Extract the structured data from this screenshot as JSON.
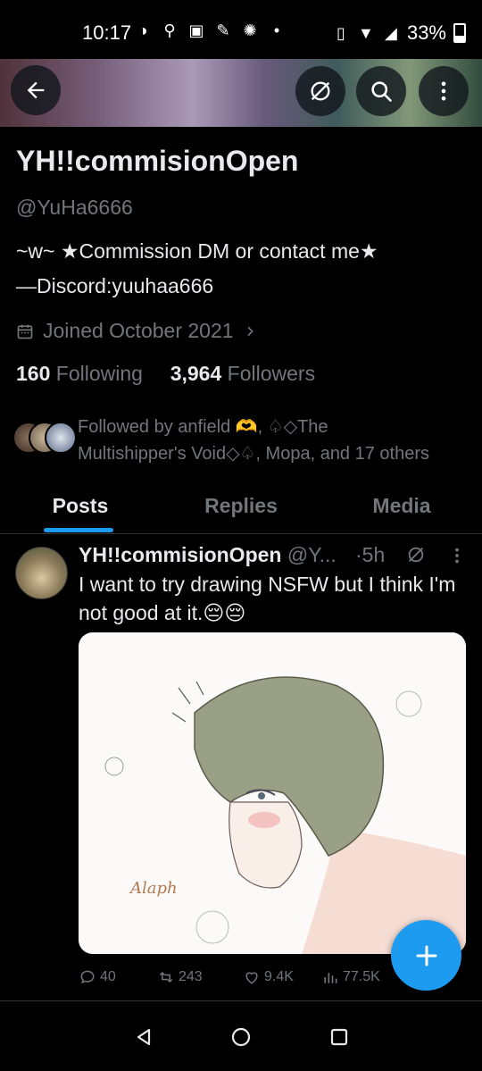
{
  "status_bar": {
    "time": "10:17",
    "battery": "33%"
  },
  "header": {
    "back_icon": "arrow-left-icon",
    "grok_icon": "grok-icon",
    "search_icon": "search-icon",
    "more_icon": "more-vertical-icon"
  },
  "profile": {
    "display_name": "YH!!commisionOpen",
    "handle": "@YuHa6666",
    "bio_line1": "~w~  ★Commission DM or contact me★",
    "bio_line2": "—Discord:yuuhaa666",
    "joined": "Joined October 2021",
    "following_count": "160",
    "following_label": "Following",
    "followers_count": "3,964",
    "followers_label": "Followers",
    "followed_by_line1": "Followed by anfield 🫶, ♤◇The",
    "followed_by_line2": "Multishipper's Void◇♤, Mopa, and 17 others"
  },
  "tabs": [
    {
      "label": "Posts"
    },
    {
      "label": "Replies"
    },
    {
      "label": "Media"
    }
  ],
  "post": {
    "author": "YH!!commisionOpen",
    "handle": "@Y...",
    "time": "·5h",
    "text": "I want to try drawing NSFW but I think I'm not good at it.😔😔",
    "image_signature": "Alaph",
    "stats": {
      "replies": "40",
      "reposts": "243",
      "likes": "9.4K",
      "views": "77.5K"
    }
  },
  "colors": {
    "accent": "#1d9bf0",
    "muted": "#71767b",
    "text": "#e7e9ea",
    "background": "#000000"
  }
}
